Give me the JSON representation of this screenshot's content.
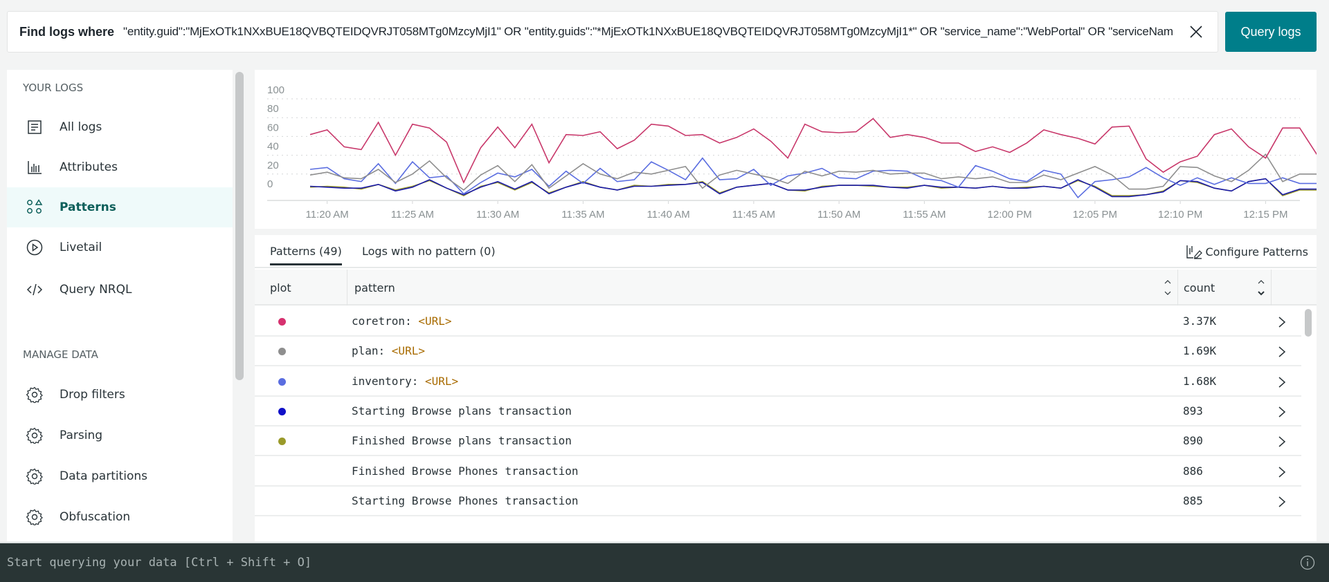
{
  "query_bar": {
    "label": "Find logs where",
    "query": "\"entity.guid\":\"MjExOTk1NXxBUE18QVBQTEIDQVRJT058MTg0MzcyMjI1\" OR \"entity.guids\":\"*MjExOTk1NXxBUE18QVBQTEIDQVRJT058MTg0MzcyMjI1*\" OR \"service_name\":\"WebPortal\" OR \"serviceNam",
    "submit_label": "Query logs"
  },
  "sidebar": {
    "sections": [
      {
        "title": "YOUR LOGS",
        "items": [
          {
            "label": "All logs",
            "icon": "document-lines-icon",
            "active": false
          },
          {
            "label": "Attributes",
            "icon": "bar-chart-icon",
            "active": false
          },
          {
            "label": "Patterns",
            "icon": "shapes-icon",
            "active": true
          },
          {
            "label": "Livetail",
            "icon": "play-circle-icon",
            "active": false
          },
          {
            "label": "Query NRQL",
            "icon": "code-icon",
            "active": false
          }
        ]
      },
      {
        "title": "MANAGE DATA",
        "items": [
          {
            "label": "Drop filters",
            "icon": "gear-icon",
            "active": false
          },
          {
            "label": "Parsing",
            "icon": "gear-icon",
            "active": false
          },
          {
            "label": "Data partitions",
            "icon": "gear-icon",
            "active": false
          },
          {
            "label": "Obfuscation",
            "icon": "gear-icon",
            "active": false
          }
        ]
      }
    ]
  },
  "patterns_panel": {
    "tabs": [
      {
        "label": "Patterns (49)",
        "active": true
      },
      {
        "label": "Logs with no pattern (0)",
        "active": false
      }
    ],
    "configure_label": "Configure Patterns",
    "columns": {
      "plot": "plot",
      "pattern": "pattern",
      "count": "count"
    },
    "rows": [
      {
        "prefix": "coretron: ",
        "variable": "<URL>",
        "count": "3.37K",
        "color": "#d6316f"
      },
      {
        "prefix": "plan: ",
        "variable": "<URL>",
        "count": "1.69K",
        "color": "#8e8e8e"
      },
      {
        "prefix": "inventory: ",
        "variable": "<URL>",
        "count": "1.68K",
        "color": "#5a6de0"
      },
      {
        "prefix": "Starting Browse plans transaction",
        "variable": "",
        "count": "893",
        "color": "#1010c8"
      },
      {
        "prefix": "Finished Browse plans transaction",
        "variable": "",
        "count": "890",
        "color": "#9a9a2a"
      },
      {
        "prefix": "Finished Browse Phones transaction",
        "variable": "",
        "count": "886",
        "color": ""
      },
      {
        "prefix": "Starting Browse Phones transaction",
        "variable": "",
        "count": "885",
        "color": ""
      }
    ]
  },
  "nerdbar": {
    "placeholder": "Start querying your data [Ctrl + Shift + O]"
  },
  "chart_data": {
    "type": "line",
    "title": "",
    "xlabel": "",
    "ylabel": "",
    "ylim": [
      0,
      100
    ],
    "yticks": [
      0,
      20,
      40,
      60,
      80,
      100
    ],
    "xtick_labels": [
      "11:20 AM",
      "11:25 AM",
      "11:30 AM",
      "11:35 AM",
      "11:40 AM",
      "11:45 AM",
      "11:50 AM",
      "11:55 AM",
      "12:00 PM",
      "12:05 PM",
      "12:10 PM",
      "12:15 PM"
    ],
    "x_start_minutes_before_first_tick": 1,
    "x_step_minutes": 1,
    "grid": true,
    "legend": "none",
    "series": [
      {
        "name": "coretron: <URL>",
        "color": "#c8376a",
        "values": [
          62,
          67,
          49,
          46,
          75,
          40,
          73,
          69,
          54,
          11,
          48,
          70,
          48,
          73,
          32,
          62,
          61,
          65,
          47,
          56,
          73,
          71,
          61,
          62,
          53,
          59,
          68,
          55,
          37,
          73,
          65,
          64,
          65,
          79,
          59,
          62,
          59,
          53,
          53,
          44,
          49,
          43,
          53,
          67,
          62,
          58,
          52,
          70,
          71,
          36,
          22,
          33,
          39,
          62,
          68,
          49,
          37,
          69,
          69,
          41,
          41
        ]
      },
      {
        "name": "plan: <URL>",
        "color": "#8e8e8e",
        "values": [
          19,
          22,
          16,
          15,
          25,
          11,
          20,
          34,
          16,
          3,
          19,
          29,
          12,
          30,
          5,
          18,
          31,
          20,
          15,
          22,
          20,
          24,
          28,
          5,
          19,
          24,
          20,
          16,
          10,
          23,
          18,
          23,
          22,
          24,
          20,
          21,
          21,
          15,
          17,
          15,
          17,
          11,
          11,
          19,
          14,
          21,
          28,
          19,
          4,
          4,
          7,
          28,
          27,
          18,
          12,
          24,
          41,
          12,
          20,
          20,
          20
        ]
      },
      {
        "name": "inventory: <URL>",
        "color": "#5a6de0",
        "values": [
          25,
          27,
          15,
          12,
          31,
          10,
          33,
          16,
          18,
          -1,
          11,
          21,
          17,
          25,
          7,
          23,
          10,
          26,
          12,
          14,
          33,
          24,
          14,
          37,
          14,
          15,
          25,
          8,
          18,
          21,
          26,
          16,
          15,
          23,
          24,
          23,
          15,
          13,
          6,
          29,
          23,
          15,
          12,
          24,
          20,
          -5,
          12,
          14,
          17,
          27,
          16,
          8,
          16,
          9,
          16,
          10,
          10,
          16,
          10,
          10,
          10
        ]
      },
      {
        "name": "Starting Browse plans transaction",
        "color": "#1a1aaa",
        "values": [
          7,
          6,
          5,
          5,
          9,
          2,
          6,
          14,
          5,
          -2,
          6,
          12,
          4,
          12,
          -1,
          6,
          11,
          6,
          3,
          7,
          7,
          8,
          9,
          11,
          -1,
          6,
          8,
          10,
          3,
          3,
          6,
          8,
          8,
          8,
          6,
          5,
          8,
          6,
          6,
          5,
          7,
          5,
          5,
          7,
          5,
          14,
          6,
          -4,
          -4,
          -2,
          1,
          13,
          12,
          5,
          2,
          12,
          15,
          -2,
          4,
          4,
          4
        ]
      },
      {
        "name": "Finished Browse plans transaction",
        "color": "#9a9a2a",
        "values": [
          6,
          7,
          6,
          4,
          9,
          3,
          7,
          13,
          5,
          -3,
          7,
          11,
          3,
          11,
          0,
          6,
          12,
          6,
          3,
          8,
          7,
          9,
          9,
          12,
          0,
          6,
          8,
          10,
          3,
          2,
          7,
          8,
          8,
          7,
          6,
          6,
          8,
          5,
          6,
          5,
          7,
          5,
          6,
          7,
          5,
          13,
          7,
          -3,
          -3,
          -2,
          2,
          13,
          11,
          5,
          2,
          12,
          15,
          -3,
          3,
          3,
          3
        ]
      }
    ]
  }
}
